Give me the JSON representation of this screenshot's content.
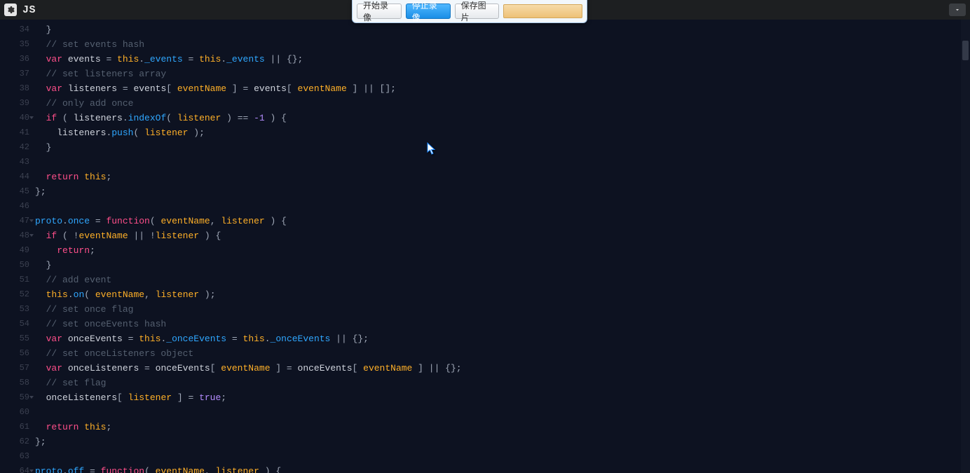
{
  "header": {
    "language_label": "JS"
  },
  "recorder": {
    "start_label": "开始录像",
    "stop_label": "停止录像",
    "save_label": "保存图片"
  },
  "gutter": {
    "start": 34,
    "end": 64,
    "fold_lines": [
      40,
      47,
      48,
      59,
      64
    ]
  },
  "code_lines": [
    {
      "n": 34,
      "segs": [
        {
          "c": "punc",
          "t": "  }"
        }
      ]
    },
    {
      "n": 35,
      "segs": [
        {
          "c": "cmt",
          "t": "  // set events hash"
        }
      ]
    },
    {
      "n": 36,
      "segs": [
        {
          "c": "punc",
          "t": "  "
        },
        {
          "c": "kw",
          "t": "var"
        },
        {
          "c": "punc",
          "t": " "
        },
        {
          "c": "ident",
          "t": "events"
        },
        {
          "c": "punc",
          "t": " = "
        },
        {
          "c": "this",
          "t": "this"
        },
        {
          "c": "punc",
          "t": "."
        },
        {
          "c": "prop",
          "t": "_events"
        },
        {
          "c": "punc",
          "t": " = "
        },
        {
          "c": "this",
          "t": "this"
        },
        {
          "c": "punc",
          "t": "."
        },
        {
          "c": "prop",
          "t": "_events"
        },
        {
          "c": "punc",
          "t": " || {};"
        }
      ]
    },
    {
      "n": 37,
      "segs": [
        {
          "c": "cmt",
          "t": "  // set listeners array"
        }
      ]
    },
    {
      "n": 38,
      "segs": [
        {
          "c": "punc",
          "t": "  "
        },
        {
          "c": "kw",
          "t": "var"
        },
        {
          "c": "punc",
          "t": " "
        },
        {
          "c": "ident",
          "t": "listeners"
        },
        {
          "c": "punc",
          "t": " = "
        },
        {
          "c": "ident",
          "t": "events"
        },
        {
          "c": "punc",
          "t": "[ "
        },
        {
          "c": "param",
          "t": "eventName"
        },
        {
          "c": "punc",
          "t": " ] = "
        },
        {
          "c": "ident",
          "t": "events"
        },
        {
          "c": "punc",
          "t": "[ "
        },
        {
          "c": "param",
          "t": "eventName"
        },
        {
          "c": "punc",
          "t": " ] || [];"
        }
      ]
    },
    {
      "n": 39,
      "segs": [
        {
          "c": "cmt",
          "t": "  // only add once"
        }
      ]
    },
    {
      "n": 40,
      "segs": [
        {
          "c": "punc",
          "t": "  "
        },
        {
          "c": "kw",
          "t": "if"
        },
        {
          "c": "punc",
          "t": " ( "
        },
        {
          "c": "ident",
          "t": "listeners"
        },
        {
          "c": "punc",
          "t": "."
        },
        {
          "c": "fn",
          "t": "indexOf"
        },
        {
          "c": "punc",
          "t": "( "
        },
        {
          "c": "param",
          "t": "listener"
        },
        {
          "c": "punc",
          "t": " ) == "
        },
        {
          "c": "num",
          "t": "-1"
        },
        {
          "c": "punc",
          "t": " ) {"
        }
      ]
    },
    {
      "n": 41,
      "segs": [
        {
          "c": "punc",
          "t": "    "
        },
        {
          "c": "ident",
          "t": "listeners"
        },
        {
          "c": "punc",
          "t": "."
        },
        {
          "c": "fn",
          "t": "push"
        },
        {
          "c": "punc",
          "t": "( "
        },
        {
          "c": "param",
          "t": "listener"
        },
        {
          "c": "punc",
          "t": " );"
        }
      ]
    },
    {
      "n": 42,
      "segs": [
        {
          "c": "punc",
          "t": "  }"
        }
      ]
    },
    {
      "n": 43,
      "segs": [
        {
          "c": "punc",
          "t": ""
        }
      ]
    },
    {
      "n": 44,
      "segs": [
        {
          "c": "punc",
          "t": "  "
        },
        {
          "c": "kw",
          "t": "return"
        },
        {
          "c": "punc",
          "t": " "
        },
        {
          "c": "this",
          "t": "this"
        },
        {
          "c": "punc",
          "t": ";"
        }
      ]
    },
    {
      "n": 45,
      "segs": [
        {
          "c": "punc",
          "t": "};"
        }
      ]
    },
    {
      "n": 46,
      "segs": [
        {
          "c": "punc",
          "t": ""
        }
      ]
    },
    {
      "n": 47,
      "segs": [
        {
          "c": "fn",
          "t": "proto"
        },
        {
          "c": "punc",
          "t": "."
        },
        {
          "c": "prop",
          "t": "once"
        },
        {
          "c": "punc",
          "t": " = "
        },
        {
          "c": "kw",
          "t": "function"
        },
        {
          "c": "punc",
          "t": "( "
        },
        {
          "c": "param",
          "t": "eventName"
        },
        {
          "c": "punc",
          "t": ", "
        },
        {
          "c": "param",
          "t": "listener"
        },
        {
          "c": "punc",
          "t": " ) {"
        }
      ]
    },
    {
      "n": 48,
      "segs": [
        {
          "c": "punc",
          "t": "  "
        },
        {
          "c": "kw",
          "t": "if"
        },
        {
          "c": "punc",
          "t": " ( !"
        },
        {
          "c": "param",
          "t": "eventName"
        },
        {
          "c": "punc",
          "t": " || !"
        },
        {
          "c": "param",
          "t": "listener"
        },
        {
          "c": "punc",
          "t": " ) {"
        }
      ]
    },
    {
      "n": 49,
      "segs": [
        {
          "c": "punc",
          "t": "    "
        },
        {
          "c": "kw",
          "t": "return"
        },
        {
          "c": "punc",
          "t": ";"
        }
      ]
    },
    {
      "n": 50,
      "segs": [
        {
          "c": "punc",
          "t": "  }"
        }
      ]
    },
    {
      "n": 51,
      "segs": [
        {
          "c": "cmt",
          "t": "  // add event"
        }
      ]
    },
    {
      "n": 52,
      "segs": [
        {
          "c": "punc",
          "t": "  "
        },
        {
          "c": "this",
          "t": "this"
        },
        {
          "c": "punc",
          "t": "."
        },
        {
          "c": "fn",
          "t": "on"
        },
        {
          "c": "punc",
          "t": "( "
        },
        {
          "c": "param",
          "t": "eventName"
        },
        {
          "c": "punc",
          "t": ", "
        },
        {
          "c": "param",
          "t": "listener"
        },
        {
          "c": "punc",
          "t": " );"
        }
      ]
    },
    {
      "n": 53,
      "segs": [
        {
          "c": "cmt",
          "t": "  // set once flag"
        }
      ]
    },
    {
      "n": 54,
      "segs": [
        {
          "c": "cmt",
          "t": "  // set onceEvents hash"
        }
      ]
    },
    {
      "n": 55,
      "segs": [
        {
          "c": "punc",
          "t": "  "
        },
        {
          "c": "kw",
          "t": "var"
        },
        {
          "c": "punc",
          "t": " "
        },
        {
          "c": "ident",
          "t": "onceEvents"
        },
        {
          "c": "punc",
          "t": " = "
        },
        {
          "c": "this",
          "t": "this"
        },
        {
          "c": "punc",
          "t": "."
        },
        {
          "c": "prop",
          "t": "_onceEvents"
        },
        {
          "c": "punc",
          "t": " = "
        },
        {
          "c": "this",
          "t": "this"
        },
        {
          "c": "punc",
          "t": "."
        },
        {
          "c": "prop",
          "t": "_onceEvents"
        },
        {
          "c": "punc",
          "t": " || {};"
        }
      ]
    },
    {
      "n": 56,
      "segs": [
        {
          "c": "cmt",
          "t": "  // set onceListeners object"
        }
      ]
    },
    {
      "n": 57,
      "segs": [
        {
          "c": "punc",
          "t": "  "
        },
        {
          "c": "kw",
          "t": "var"
        },
        {
          "c": "punc",
          "t": " "
        },
        {
          "c": "ident",
          "t": "onceListeners"
        },
        {
          "c": "punc",
          "t": " = "
        },
        {
          "c": "ident",
          "t": "onceEvents"
        },
        {
          "c": "punc",
          "t": "[ "
        },
        {
          "c": "param",
          "t": "eventName"
        },
        {
          "c": "punc",
          "t": " ] = "
        },
        {
          "c": "ident",
          "t": "onceEvents"
        },
        {
          "c": "punc",
          "t": "[ "
        },
        {
          "c": "param",
          "t": "eventName"
        },
        {
          "c": "punc",
          "t": " ] || {};"
        }
      ]
    },
    {
      "n": 58,
      "segs": [
        {
          "c": "cmt",
          "t": "  // set flag"
        }
      ]
    },
    {
      "n": 59,
      "segs": [
        {
          "c": "punc",
          "t": "  "
        },
        {
          "c": "ident",
          "t": "onceListeners"
        },
        {
          "c": "punc",
          "t": "[ "
        },
        {
          "c": "param",
          "t": "listener"
        },
        {
          "c": "punc",
          "t": " ] = "
        },
        {
          "c": "bool",
          "t": "true"
        },
        {
          "c": "punc",
          "t": ";"
        }
      ]
    },
    {
      "n": 60,
      "segs": [
        {
          "c": "punc",
          "t": ""
        }
      ]
    },
    {
      "n": 61,
      "segs": [
        {
          "c": "punc",
          "t": "  "
        },
        {
          "c": "kw",
          "t": "return"
        },
        {
          "c": "punc",
          "t": " "
        },
        {
          "c": "this",
          "t": "this"
        },
        {
          "c": "punc",
          "t": ";"
        }
      ]
    },
    {
      "n": 62,
      "segs": [
        {
          "c": "punc",
          "t": "};"
        }
      ]
    },
    {
      "n": 63,
      "segs": [
        {
          "c": "punc",
          "t": ""
        }
      ]
    },
    {
      "n": 64,
      "segs": [
        {
          "c": "fn",
          "t": "proto"
        },
        {
          "c": "punc",
          "t": "."
        },
        {
          "c": "prop",
          "t": "off"
        },
        {
          "c": "punc",
          "t": " = "
        },
        {
          "c": "kw",
          "t": "function"
        },
        {
          "c": "punc",
          "t": "( "
        },
        {
          "c": "param",
          "t": "eventName"
        },
        {
          "c": "punc",
          "t": ", "
        },
        {
          "c": "param",
          "t": "listener"
        },
        {
          "c": "punc",
          "t": " ) {"
        }
      ]
    }
  ]
}
